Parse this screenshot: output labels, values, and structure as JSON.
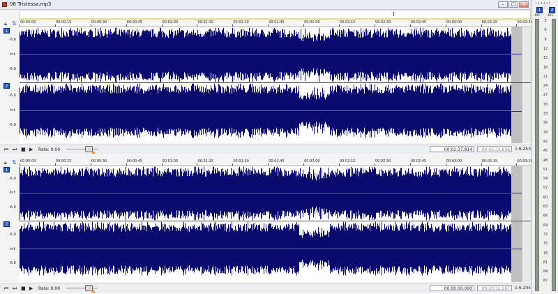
{
  "window": {
    "title": "08 Tristessa.mp3",
    "min_label": "–",
    "max_label": "□",
    "close_label": "✕"
  },
  "ruler_labels": [
    "00:00:00",
    "00:00:15",
    "00:00:30",
    "00:00:45",
    "00:01:00",
    "00:01:15",
    "00:01:30",
    "00:01:45",
    "00:02:00",
    "00:02:15",
    "00:02:30",
    "00:02:45",
    "00:03:00",
    "00:03:15",
    "00:03:30"
  ],
  "db_labels": [
    "-6.0",
    "-Inf.",
    "-6.0",
    "-6.0",
    "-Inf.",
    "-6.0"
  ],
  "panels": [
    {
      "channels": [
        "1",
        "2"
      ],
      "rate_label": "Rate: 0.00",
      "position": "00:02:37.814",
      "length": "00:03:33.636",
      "zoom": "1:6,253"
    },
    {
      "channels": [
        "1",
        "2"
      ],
      "rate_label": "Rate: 0.00",
      "position": "00:00:00.000",
      "length": "00:03:32.297",
      "zoom": "1:6,205"
    }
  ],
  "meter": {
    "header": "••••••",
    "channels": [
      "1",
      "2"
    ],
    "left_small": "-Inf.",
    "right_small": "-Inf.",
    "scale": [
      "3",
      "6",
      "9",
      "12",
      "15",
      "18",
      "21",
      "24",
      "27",
      "30",
      "33",
      "36",
      "39",
      "42",
      "45",
      "48",
      "51",
      "54",
      "57",
      "60",
      "63",
      "66",
      "69",
      "72",
      "75",
      "78",
      "81",
      "84",
      "87"
    ]
  },
  "colors": {
    "waveform": "#0a0a6e",
    "selection": "#c0c0c0",
    "channel_badge": "#2456c8",
    "meter_bar": "#8a9a86"
  },
  "icons": [
    "lock-icon",
    "snap-icon",
    "go-start-icon",
    "go-end-icon",
    "stop-icon",
    "play-icon"
  ]
}
